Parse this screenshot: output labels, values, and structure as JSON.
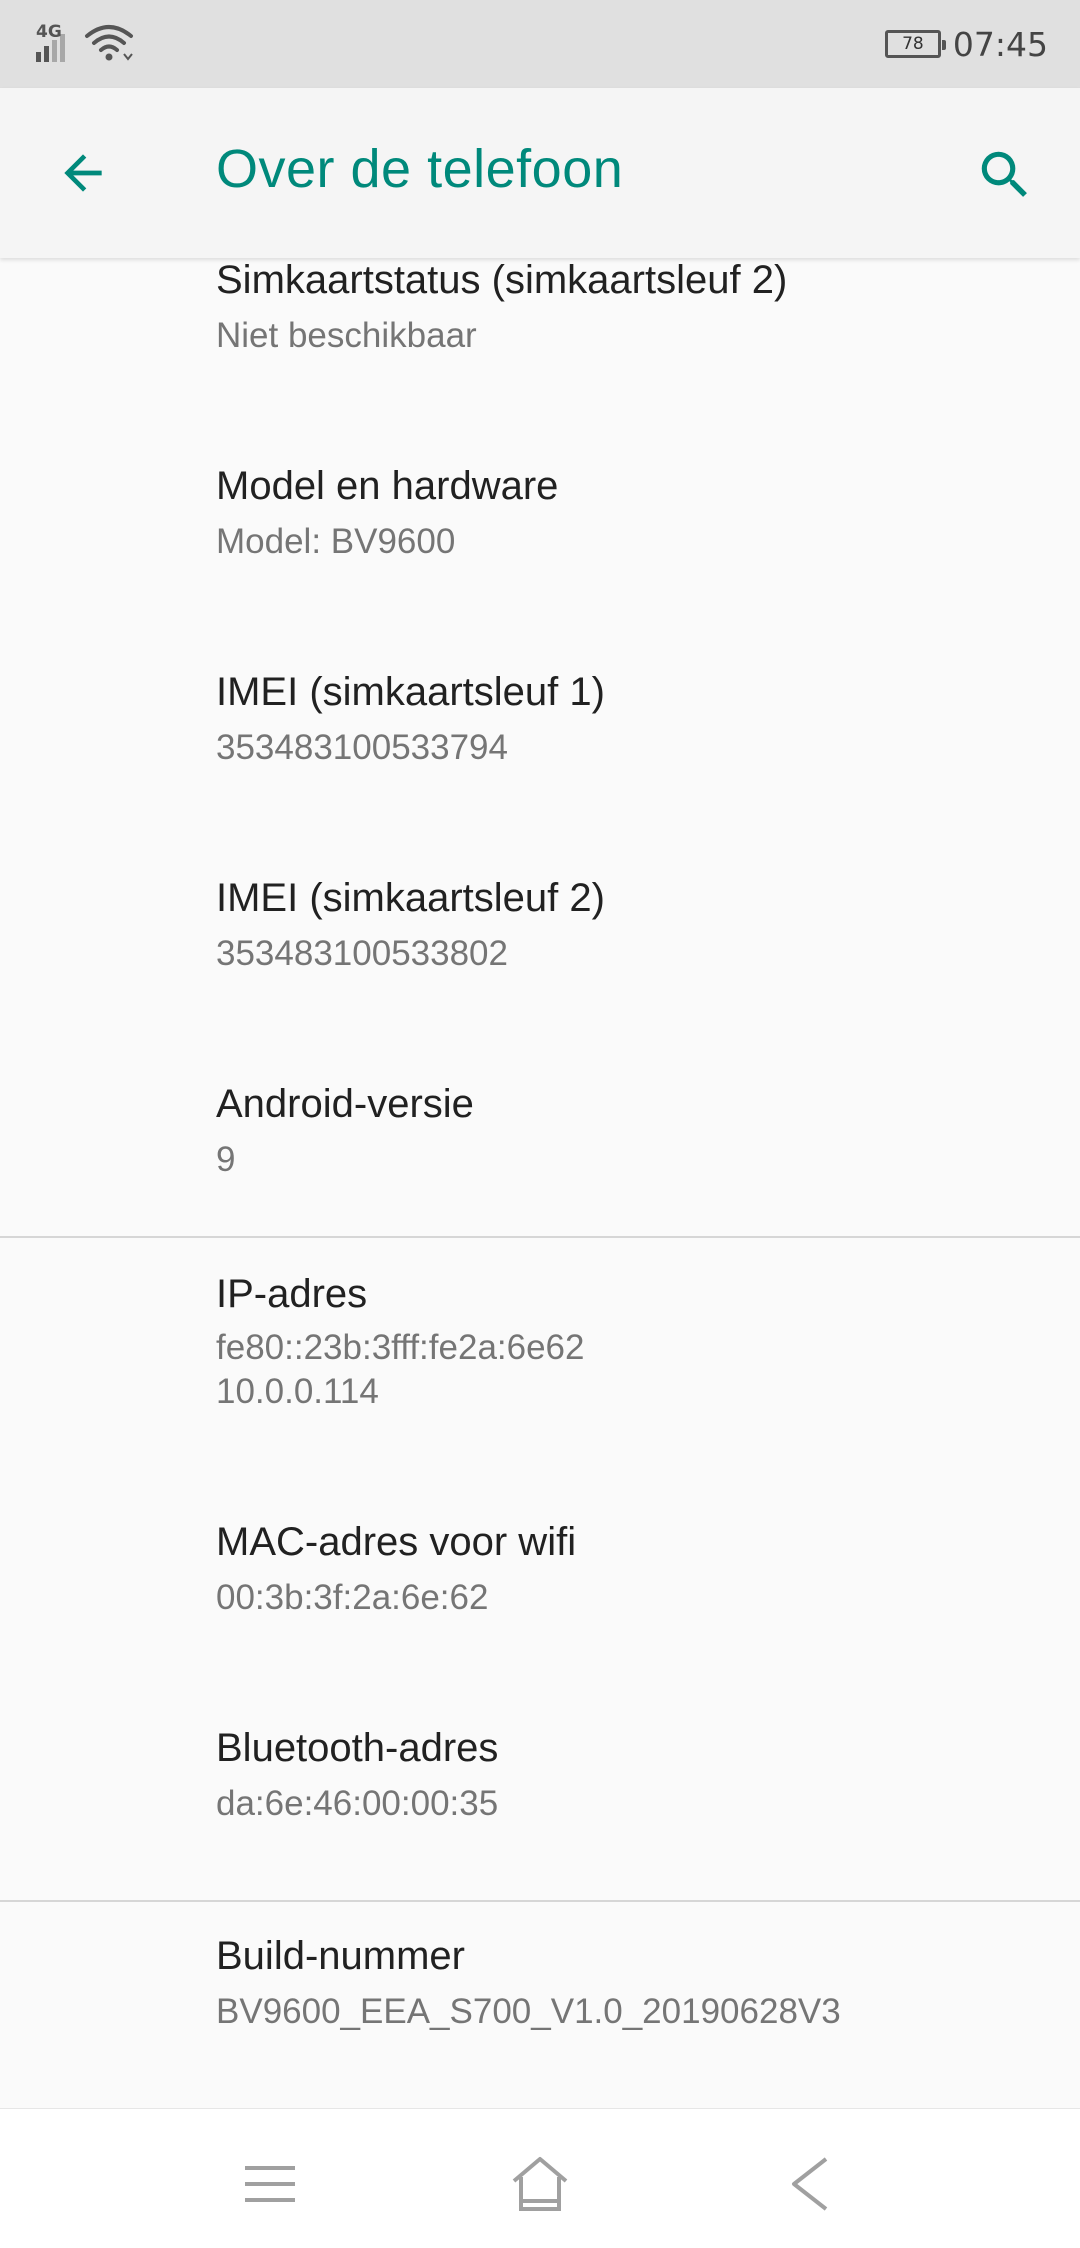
{
  "status_bar": {
    "network_type": "4G",
    "battery_level": "78",
    "time": "07:45"
  },
  "app_bar": {
    "title": "Over de telefoon",
    "back_icon": "arrow-back-icon",
    "search_icon": "search-icon"
  },
  "items": [
    {
      "title": "Simkaartstatus (simkaartsleuf 2)",
      "summary": "Niet beschikbaar"
    },
    {
      "title": "Model en hardware",
      "summary": "Model: BV9600"
    },
    {
      "title": "IMEI (simkaartsleuf 1)",
      "summary": "353483100533794"
    },
    {
      "title": "IMEI (simkaartsleuf 2)",
      "summary": "353483100533802"
    },
    {
      "title": "Android-versie",
      "summary": "9"
    },
    {
      "title": "IP-adres",
      "summary": "fe80::23b:3fff:fe2a:6e62\n10.0.0.114"
    },
    {
      "title": "MAC-adres voor wifi",
      "summary": "00:3b:3f:2a:6e:62"
    },
    {
      "title": "Bluetooth-adres",
      "summary": "da:6e:46:00:00:35"
    },
    {
      "title": "Build-nummer",
      "summary": "BV9600_EEA_S700_V1.0_20190628V3"
    }
  ],
  "nav_bar": {
    "menu_icon": "menu-icon",
    "home_icon": "home-icon",
    "back_icon": "back-icon"
  },
  "colors": {
    "accent": "#00897b",
    "title_text": "#212121",
    "summary_text": "#757575",
    "status_bar_bg": "#e0e0e0"
  }
}
